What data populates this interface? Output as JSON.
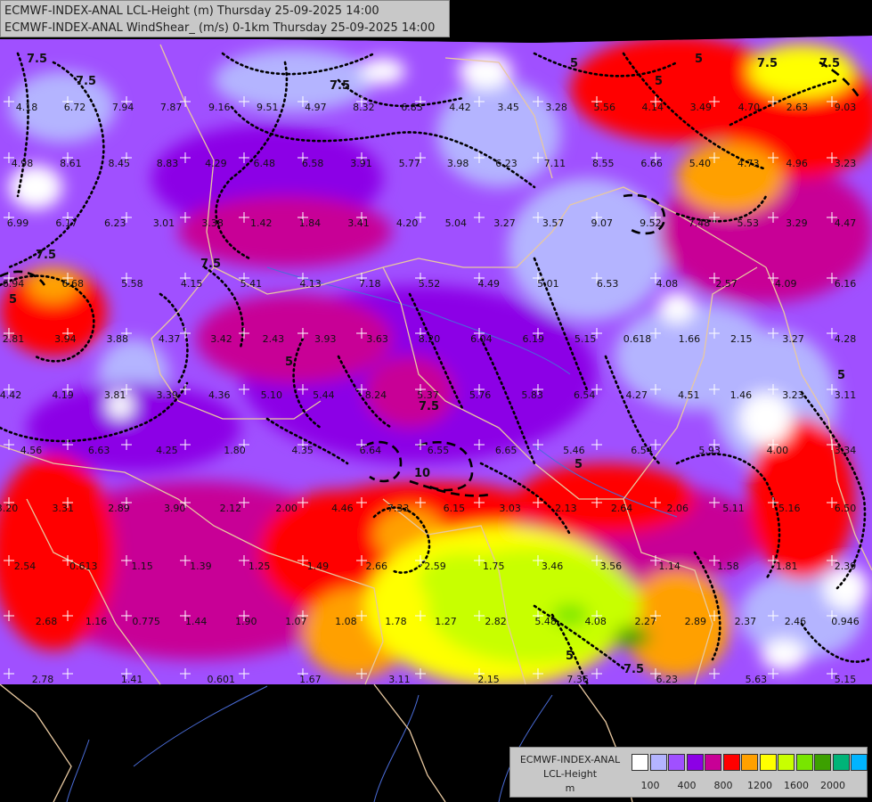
{
  "title": {
    "line1": "ECMWF-INDEX-ANAL LCL-Height (m) Thursday 25-09-2025 14:00",
    "line2": "ECMWF-INDEX-ANAL WindShear_ (m/s) 0-1km Thursday 25-09-2025 14:00"
  },
  "legend": {
    "title_line1": "ECMWF-INDEX-ANAL",
    "title_line2": "LCL-Height",
    "title_line3": "m",
    "colors": [
      "#ffffff",
      "#b4b4ff",
      "#a050ff",
      "#8c00e6",
      "#c80096",
      "#ff0000",
      "#ffa000",
      "#ffff00",
      "#c8ff00",
      "#78e600",
      "#3ca000",
      "#00b478",
      "#00b4ff"
    ],
    "ticks": [
      "100",
      "400",
      "800",
      "1200",
      "1600",
      "2000"
    ]
  },
  "map_values": [
    "4.18",
    "6.72",
    "7.94",
    "7.87",
    "9.16",
    "9.51",
    "4.97",
    "8.32",
    "6.83",
    "4.42",
    "3.45",
    "3.28",
    "5.56",
    "4.14",
    "3.49",
    "4.70",
    "2.63",
    "9.03",
    "4.98",
    "8.61",
    "8.45",
    "8.83",
    "4.29",
    "6.48",
    "6.58",
    "3.91",
    "5.77",
    "3.98",
    "6.23",
    "7.11",
    "8.55",
    "6.66",
    "5.40",
    "4.73",
    "4.96",
    "3.23",
    "6.99",
    "6.17",
    "6.23",
    "3.01",
    "3.38",
    "1.42",
    "1.84",
    "3.41",
    "4.20",
    "5.04",
    "3.27",
    "3.57",
    "9.07",
    "9.52",
    "7.48",
    "5.53",
    "3.29",
    "4.47",
    "6.94",
    "6.68",
    "5.58",
    "4.15",
    "5.41",
    "4.13",
    "7.18",
    "5.52",
    "4.49",
    "5.01",
    "6.53",
    "4.08",
    "2.57",
    "4.09",
    "6.16",
    "2.81",
    "3.94",
    "3.88",
    "4.37",
    "3.42",
    "2.43",
    "3.93",
    "3.63",
    "8.20",
    "6.04",
    "6.19",
    "5.15",
    "0.618",
    "1.66",
    "2.15",
    "3.27",
    "4.28",
    "4.42",
    "4.19",
    "3.81",
    "3.39",
    "4.36",
    "5.10",
    "5.44",
    "8.24",
    "5.37",
    "5.76",
    "5.83",
    "6.54",
    "4.27",
    "4.51",
    "1.46",
    "3.23",
    "3.11",
    "4.56",
    "6.63",
    "4.25",
    "1.80",
    "4.35",
    "6.64",
    "6.55",
    "6.65",
    "5.46",
    "6.54",
    "5.93",
    "4.00",
    "3.34",
    "3.20",
    "3.31",
    "2.89",
    "3.90",
    "2.12",
    "2.00",
    "4.46",
    "7.33",
    "6.15",
    "3.03",
    "2.13",
    "2.64",
    "2.06",
    "5.11",
    "5.16",
    "6.50",
    "2.54",
    "0.613",
    "1.15",
    "1.39",
    "1.25",
    "1.49",
    "2.66",
    "2.59",
    "1.75",
    "3.46",
    "3.56",
    "1.14",
    "1.58",
    "1.81",
    "2.39",
    "2.68",
    "1.16",
    "0.775",
    "1.44",
    "1.90",
    "1.07",
    "1.08",
    "1.78",
    "1.27",
    "2.82",
    "5.48",
    "4.08",
    "2.27",
    "2.89",
    "2.37",
    "2.46",
    "0.946",
    "2.78",
    "1.41",
    "0.601",
    "1.67",
    "3.11",
    "2.15",
    "7.36",
    "6.23",
    "5.63",
    "5.15"
  ],
  "contour_labels": [
    "7.5",
    "7.5",
    "7.5",
    "5",
    "5",
    "7.5",
    "7.5",
    "5",
    "7.5",
    "5",
    "7.5",
    "5",
    "10",
    "5",
    "7.5",
    "5",
    "7.5",
    "5"
  ]
}
